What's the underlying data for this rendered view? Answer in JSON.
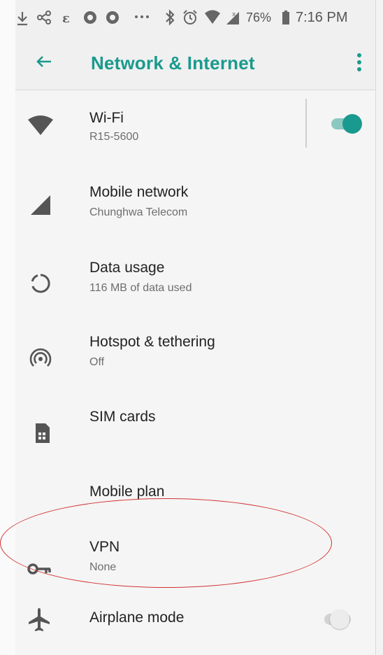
{
  "status_bar": {
    "time": "7:16 PM",
    "battery": "76%",
    "icons": [
      "download-icon",
      "share-icon",
      "app-icon",
      "app-icon",
      "app-icon",
      "more-dots-icon",
      "bluetooth-icon",
      "alarm-icon",
      "wifi-icon",
      "signal-icon",
      "battery-icon"
    ]
  },
  "app_bar": {
    "title": "Network & Internet",
    "back_icon": "arrow-left-icon",
    "menu_icon": "more-vert-icon"
  },
  "items": [
    {
      "title": "Wi-Fi",
      "subtitle": "R15-5600",
      "icon": "wifi-icon",
      "toggle": true,
      "toggle_on": true
    },
    {
      "title": "Mobile network",
      "subtitle": "Chunghwa Telecom",
      "icon": "cell-signal-icon"
    },
    {
      "title": "Data usage",
      "subtitle": "116 MB of data used",
      "icon": "data-usage-icon"
    },
    {
      "title": "Hotspot & tethering",
      "subtitle": "Off",
      "icon": "hotspot-icon"
    },
    {
      "title": "SIM cards",
      "subtitle": "",
      "icon": "sim-card-icon"
    },
    {
      "title": "Mobile plan",
      "subtitle": "",
      "icon": ""
    },
    {
      "title": "VPN",
      "subtitle": "None",
      "icon": "key-icon"
    },
    {
      "title": "Airplane mode",
      "subtitle": "",
      "icon": "airplane-icon",
      "toggle": true,
      "toggle_on": false
    }
  ],
  "colors": {
    "accent": "#1a9a8e",
    "annotation": "#d23232"
  }
}
